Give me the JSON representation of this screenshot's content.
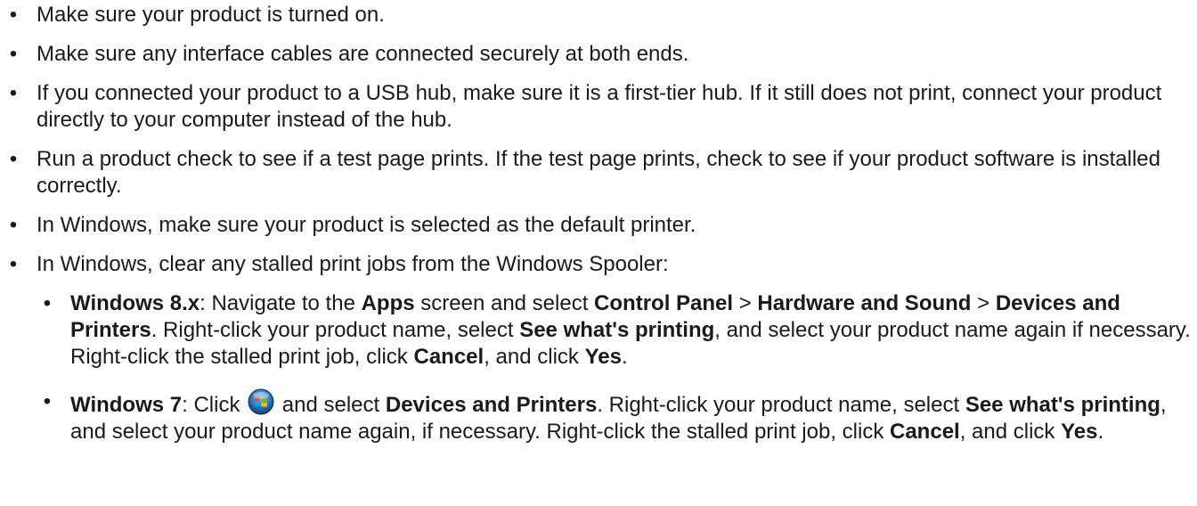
{
  "bullet_char": "•",
  "items": [
    {
      "text": "Make sure your product is turned on."
    },
    {
      "text": "Make sure any interface cables are connected securely at both ends."
    },
    {
      "text": "If you connected your product to a USB hub, make sure it is a first-tier hub. If it still does not print, connect your product directly to your computer instead of the hub."
    },
    {
      "text": "Run a product check to see if a test page prints. If the test page prints, check to see if your product software is installed correctly."
    },
    {
      "text": "In Windows, make sure your product is selected as the default printer."
    },
    {
      "text": "In Windows, clear any stalled print jobs from the Windows Spooler:"
    }
  ],
  "win8": {
    "label": "Windows 8.x",
    "t1": ": Navigate to the ",
    "apps": "Apps",
    "t2": " screen and select ",
    "control_panel": "Control Panel",
    "sep1": " > ",
    "hardware": "Hardware and Sound",
    "sep2": " > ",
    "devices": "Devices and Printers",
    "t3": ". Right-click your product name, select ",
    "see": "See what's printing",
    "t4": ", and select your product name again if necessary. Right-click the stalled print job, click ",
    "cancel": "Cancel",
    "t5": ", and click ",
    "yes": "Yes",
    "t6": "."
  },
  "win7": {
    "label": "Windows 7",
    "t1": ": Click ",
    "orb_icon": "windows-start-orb-icon",
    "t2": " and select ",
    "devices": "Devices and Printers",
    "t3": ". Right-click your product name, select ",
    "see": "See what's printing",
    "t4": ", and select your product name again, if necessary. Right-click the stalled print job, click ",
    "cancel": "Cancel",
    "t5": ", and click ",
    "yes": "Yes",
    "t6": "."
  }
}
